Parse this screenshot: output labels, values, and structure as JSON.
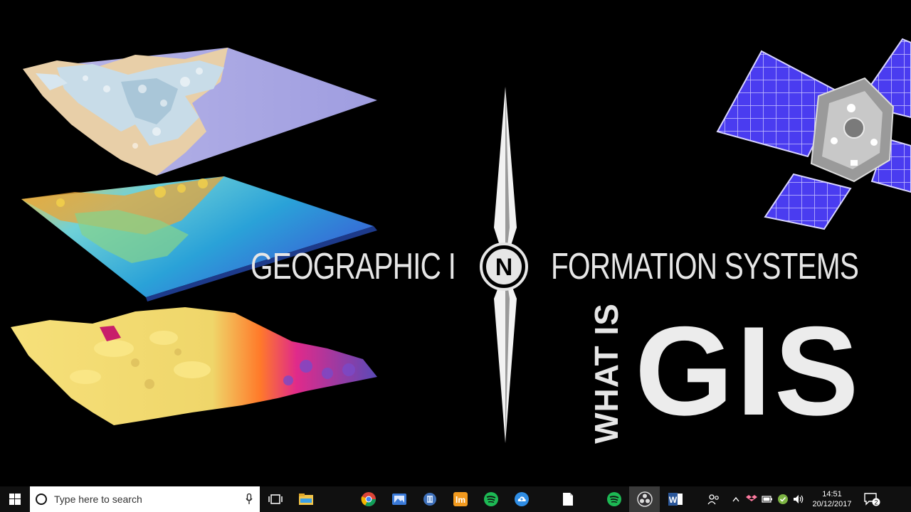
{
  "headline": {
    "left": "GEOGRAPHIC I",
    "badge_letter": "N",
    "right": "FORMATION SYSTEMS"
  },
  "tagline": {
    "what_is": "WHAT IS",
    "gis": "GIS"
  },
  "colors": {
    "background": "#000000",
    "text": "#e6e6e6",
    "taskbar": "#101010",
    "solar_panel": "#4a3cf0"
  },
  "taskbar": {
    "start_icon": "windows-icon",
    "search_placeholder": "Type here to search",
    "apps": [
      {
        "name": "task-view",
        "icon": "task-view-icon"
      },
      {
        "name": "file-explorer",
        "icon": "folder-icon"
      },
      {
        "name": "chrome",
        "icon": "chrome-icon"
      },
      {
        "name": "photos",
        "icon": "photos-icon"
      },
      {
        "name": "calculator",
        "icon": "calculator-icon"
      },
      {
        "name": "lm-app",
        "icon": "lm-icon",
        "label": "lm"
      },
      {
        "name": "spotify",
        "icon": "spotify-icon"
      },
      {
        "name": "cloud-drive",
        "icon": "cloud-upload-icon"
      },
      {
        "name": "document",
        "icon": "blank-document-icon"
      },
      {
        "name": "spotify-2",
        "icon": "spotify-icon"
      },
      {
        "name": "obs",
        "icon": "obs-icon"
      },
      {
        "name": "word",
        "icon": "word-icon",
        "label": "W"
      }
    ],
    "clock": {
      "time": "14:51",
      "date": "20/12/2017"
    },
    "notification_count": "2"
  }
}
